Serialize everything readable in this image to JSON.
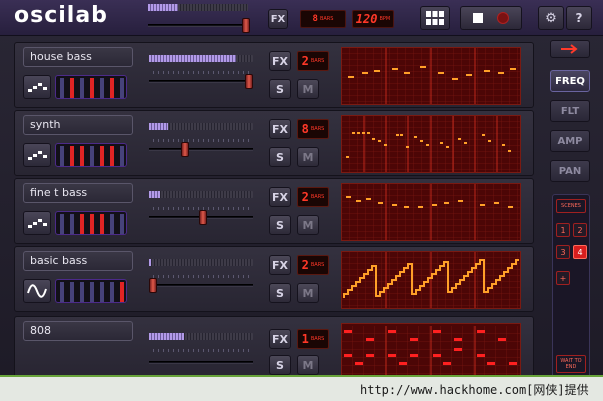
{
  "app": {
    "logo": "oscilab"
  },
  "topbar": {
    "fx_label": "FX",
    "bars_value": "8",
    "bars_unit": "BARS",
    "bpm_value": "120",
    "bpm_unit": "BPM",
    "grid_icon": "grid-icon",
    "stop_icon": "stop-icon",
    "record_icon": "record-icon",
    "settings_icon": "gear-icon",
    "help_label": "?"
  },
  "channels": [
    {
      "name": "house bass",
      "fx_label": "FX",
      "solo_label": "S",
      "mute_label": "M",
      "bars_value": "2",
      "bars_unit": "BARS",
      "wave_icon": "saw-wave-icon",
      "volume_level": 0.84,
      "fader_position": 0.95
    },
    {
      "name": "synth",
      "fx_label": "FX",
      "solo_label": "S",
      "mute_label": "M",
      "bars_value": "8",
      "bars_unit": "BARS",
      "wave_icon": "saw-wave-icon",
      "volume_level": 0.18,
      "fader_position": 0.35
    },
    {
      "name": "fine t bass",
      "fx_label": "FX",
      "solo_label": "S",
      "mute_label": "M",
      "bars_value": "2",
      "bars_unit": "BARS",
      "wave_icon": "saw-wave-icon",
      "volume_level": 0.11,
      "fader_position": 0.52
    },
    {
      "name": "basic bass",
      "fx_label": "FX",
      "solo_label": "S",
      "mute_label": "M",
      "bars_value": "2",
      "bars_unit": "BARS",
      "wave_icon": "sine-wave-icon",
      "volume_level": 0.02,
      "fader_position": 0.0
    },
    {
      "name": "808",
      "fx_label": "FX",
      "solo_label": "S",
      "mute_label": "M",
      "bars_value": "1",
      "bars_unit": "BARS",
      "wave_icon": "",
      "volume_level": 0.34,
      "fader_position": 0.0
    }
  ],
  "sidepanel": {
    "tabs": [
      "FREQ",
      "FLT",
      "AMP",
      "PAN"
    ],
    "active_tab": "FREQ",
    "expand_icon": "arrow-right-icon",
    "scenes_label": "SCENES",
    "scene_numbers": [
      "1",
      "2",
      "3",
      "4",
      "+"
    ],
    "active_scene": "4",
    "wait_label": "WAIT TO END"
  },
  "watermark": {
    "text": "http://www.hackhome.com[网侠]提供"
  },
  "colors": {
    "accent": "#e02424",
    "lcd_red": "#ff3828",
    "seq_bg": "#4c0606"
  }
}
